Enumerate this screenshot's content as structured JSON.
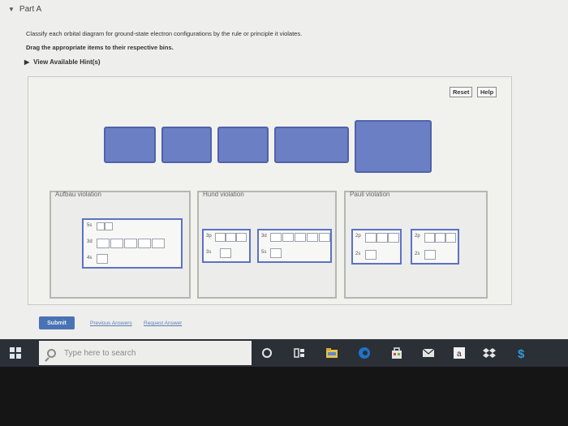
{
  "part": {
    "label": "Part A"
  },
  "prompt": "Classify each orbital diagram for ground-state electron configurations by the rule or principle it violates.",
  "instruction": "Drag the appropriate items to their respective bins.",
  "hints_label": "View Available Hint(s)",
  "toolbar": {
    "reset_label": "Reset",
    "help_label": "Help"
  },
  "bins": [
    {
      "label": "Aufbau violation",
      "cards": [
        [
          "5s"
        ],
        [
          "3d",
          "4s"
        ]
      ]
    },
    {
      "label": "Hund violation",
      "cards": [
        [
          "3p",
          "3s"
        ],
        [
          "3d",
          "5s"
        ]
      ]
    },
    {
      "label": "Pauli violation",
      "cards": [
        [
          "2p",
          "2s"
        ],
        [
          "2p",
          "2s"
        ]
      ]
    }
  ],
  "actions": {
    "submit_label": "Submit",
    "previous_answers": "Previous Answers",
    "request_answer": "Request Answer"
  },
  "taskbar": {
    "search_placeholder": "Type here to search",
    "icons": [
      "cortana-circle-icon",
      "task-view-icon",
      "file-explorer-icon",
      "edge-icon",
      "store-icon",
      "mail-icon",
      "amazon-icon",
      "dropbox-icon",
      "currency-icon"
    ]
  },
  "colors": {
    "tile": "#6b7fc5",
    "card_border": "#5c72c3",
    "submit": "#4973b5",
    "taskbar": "#2b2f36"
  }
}
